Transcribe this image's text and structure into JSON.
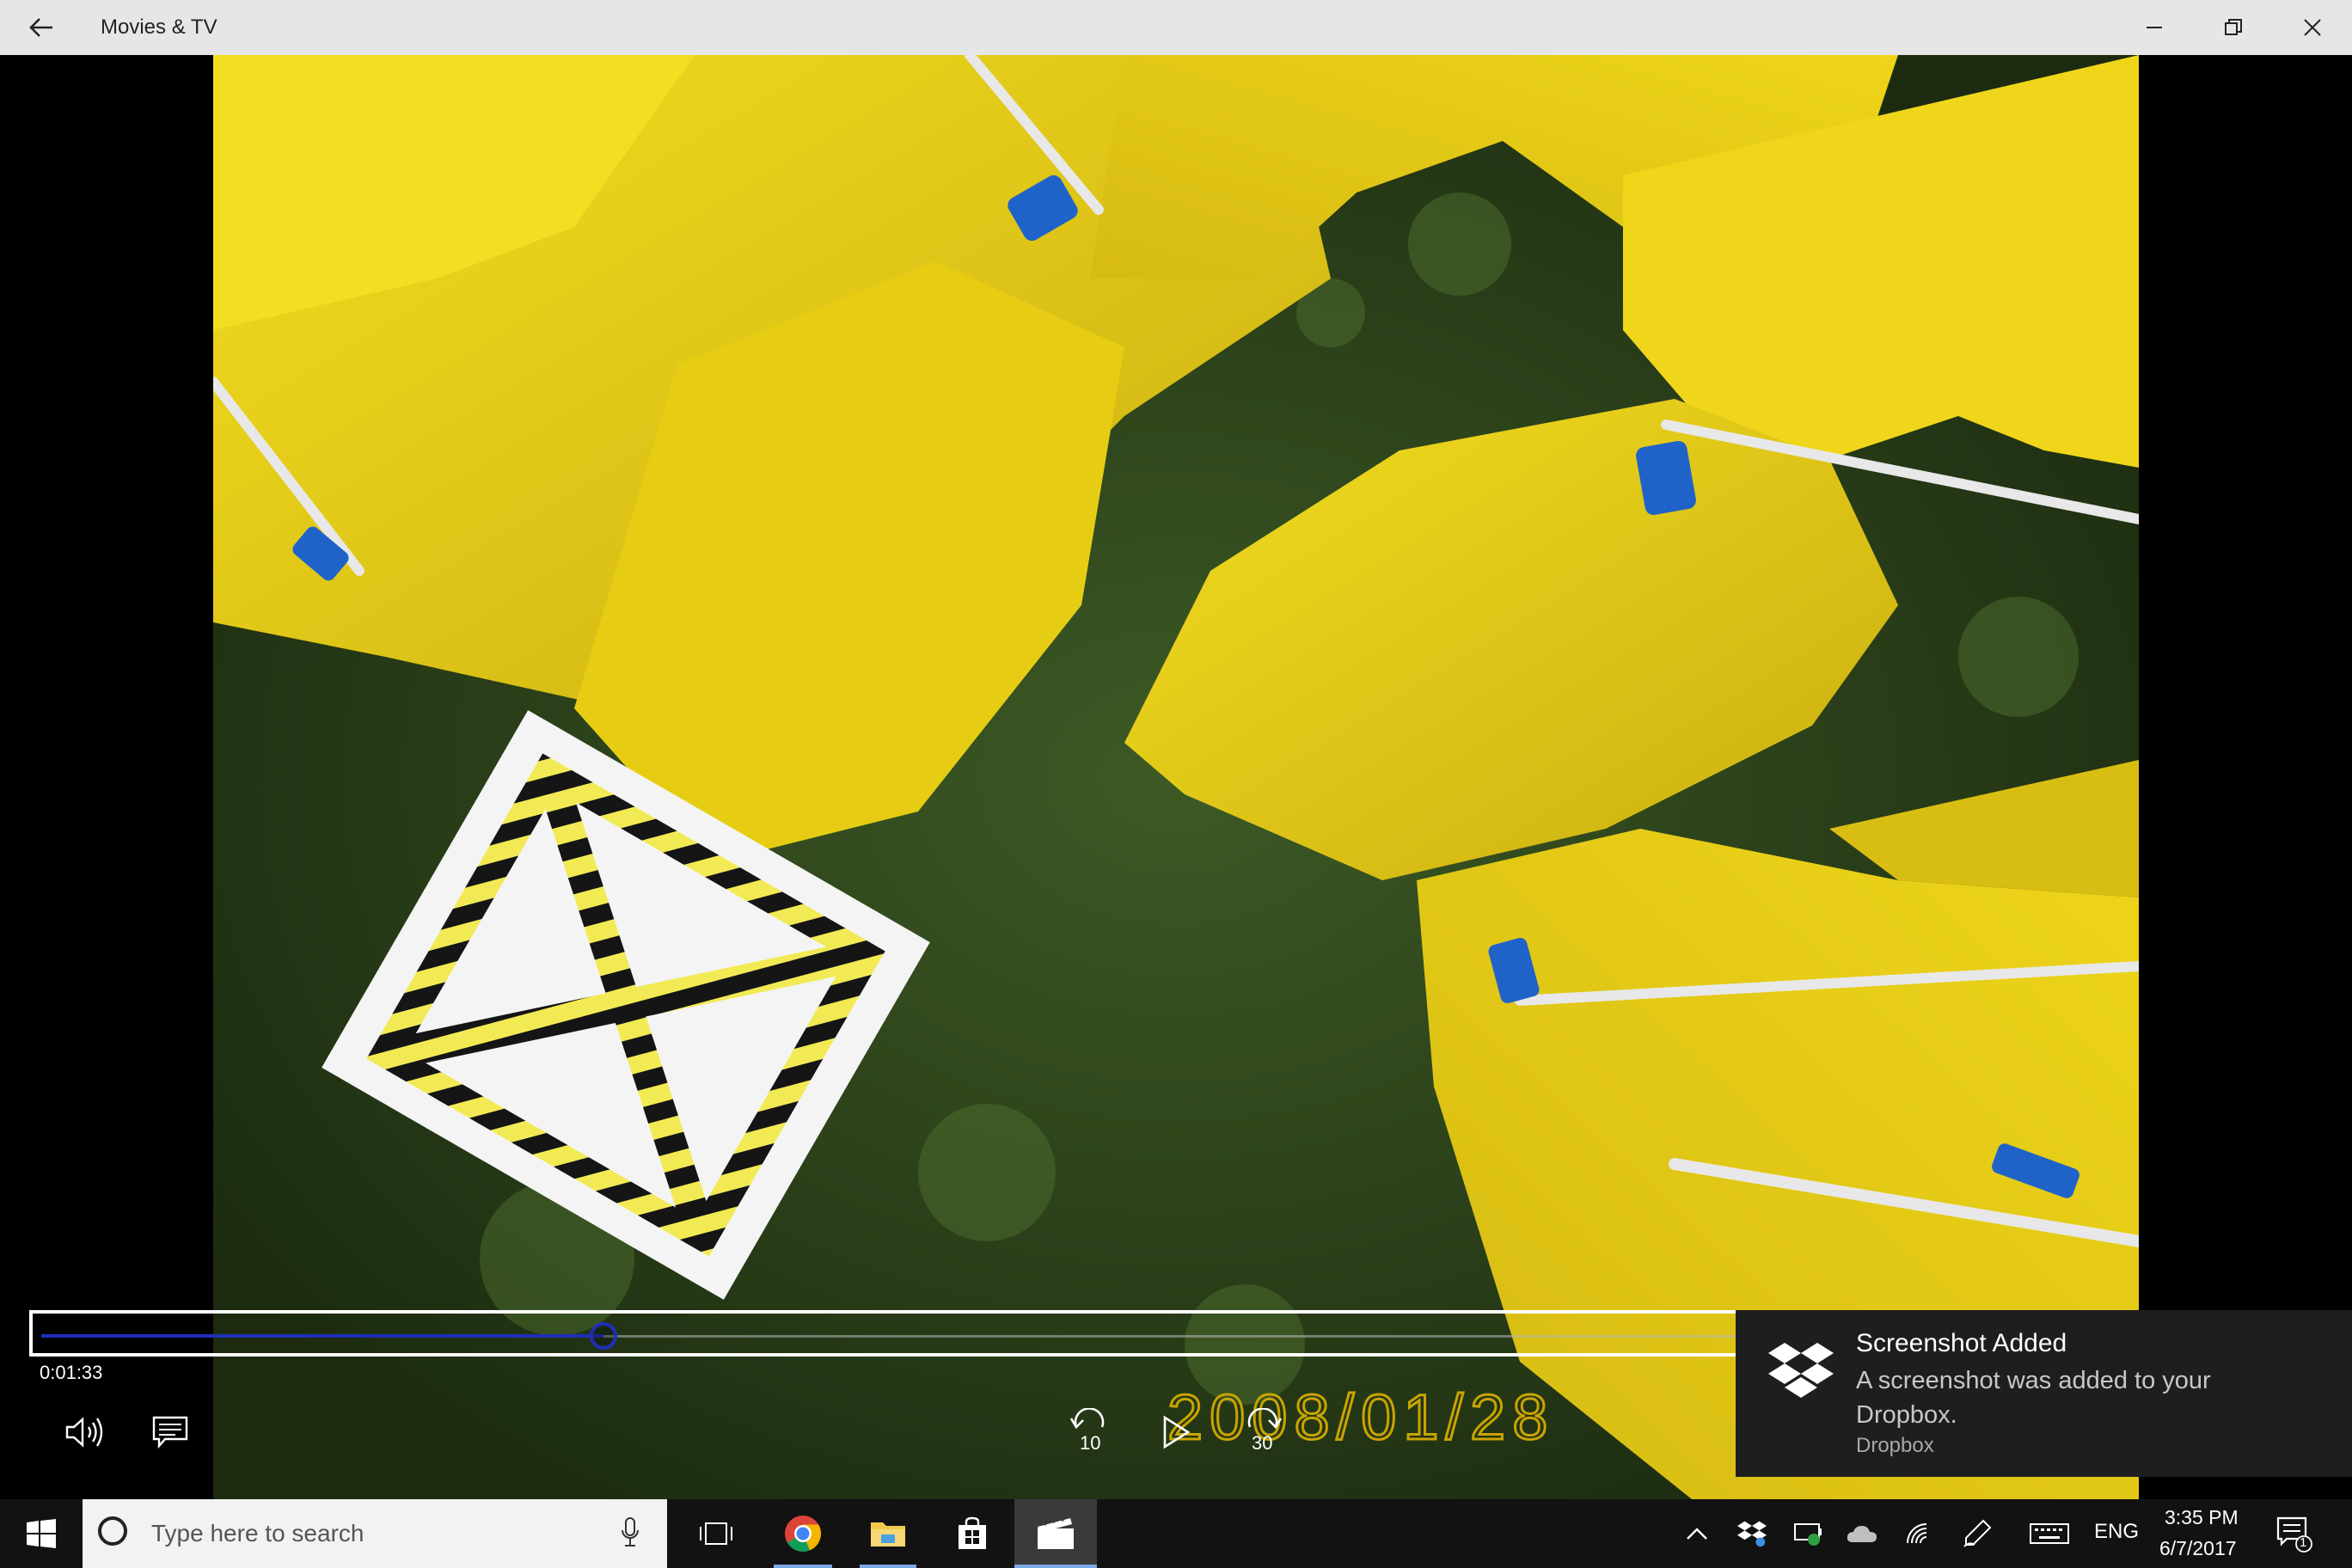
{
  "window": {
    "title": "Movies & TV",
    "back_icon": "back-arrow-icon",
    "minimize_icon": "minimize-icon",
    "maximize_icon": "restore-icon",
    "close_icon": "close-icon"
  },
  "video": {
    "description_icon": "video-frame",
    "timestamp_overlay": "2008/01/28"
  },
  "player": {
    "current_time": "0:01:33",
    "progress_fraction": 0.33,
    "controls": {
      "volume_icon": "volume-icon",
      "captions_icon": "captions-icon",
      "skip_back_label": "10",
      "play_icon": "play-icon",
      "skip_forward_label": "30"
    },
    "accent_color": "#1f2fb8"
  },
  "toast": {
    "title": "Screenshot Added",
    "body": "A screenshot was added to your Dropbox.",
    "source": "Dropbox",
    "icon": "dropbox-icon"
  },
  "taskbar": {
    "search_placeholder": "Type here to search",
    "apps": [
      "task-view-icon",
      "chrome-icon",
      "file-explorer-icon",
      "store-icon",
      "movies-tv-icon"
    ],
    "tray": {
      "language": "ENG",
      "time": "3:35 PM",
      "date": "6/7/2017",
      "notification_count": "1"
    }
  }
}
